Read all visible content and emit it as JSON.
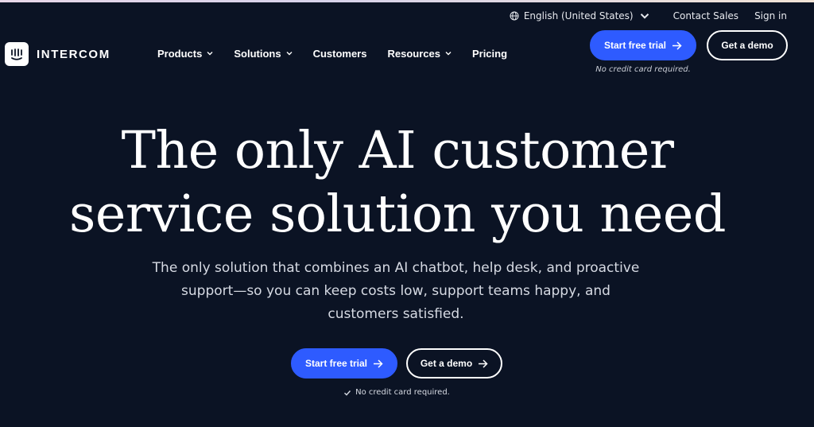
{
  "utility": {
    "language": "English (United States)",
    "contact_sales": "Contact Sales",
    "sign_in": "Sign in"
  },
  "brand": {
    "name": "INTERCOM"
  },
  "nav": {
    "items": [
      {
        "label": "Products",
        "has_dropdown": true
      },
      {
        "label": "Solutions",
        "has_dropdown": true
      },
      {
        "label": "Customers",
        "has_dropdown": false
      },
      {
        "label": "Resources",
        "has_dropdown": true
      },
      {
        "label": "Pricing",
        "has_dropdown": false
      }
    ]
  },
  "header_cta": {
    "primary": "Start free trial",
    "secondary": "Get a demo",
    "note": "No credit card required."
  },
  "hero": {
    "title_line1": "The only AI customer",
    "title_line2": "service solution you need",
    "subtitle_line1": "The only solution that combines an AI chatbot, help desk, and proactive",
    "subtitle_line2": "support—so you can keep costs low, support teams happy, and",
    "subtitle_line3": "customers satisfied.",
    "primary_cta": "Start free trial",
    "secondary_cta": "Get a demo",
    "note": "No credit card required."
  },
  "colors": {
    "background": "#0b1324",
    "accent": "#2e5bff",
    "text": "#ffffff"
  },
  "icons": {
    "language": "globe-icon",
    "dropdown": "chevron-down-icon",
    "cta": "arrow-right-icon",
    "note": "check-icon",
    "logo": "intercom-logo-icon"
  }
}
